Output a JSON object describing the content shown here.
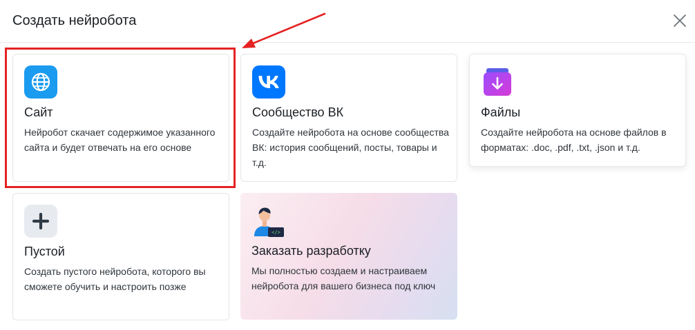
{
  "dialog": {
    "title": "Создать нейробота"
  },
  "cards": [
    {
      "title": "Сайт",
      "description": "Нейробот скачает содержимое указанного сайта и будет отвечать на его основе",
      "icon": "globe-icon"
    },
    {
      "title": "Сообщество ВК",
      "description": "Создайте нейробота на основе сообщества ВК: история сообщений, посты, товары и т.д.",
      "icon": "vk-logo-icon"
    },
    {
      "title": "Файлы",
      "description": "Создайте нейробота на основе файлов в форматах: .doc, .pdf, .txt, .json и т.д.",
      "icon": "file-download-icon"
    },
    {
      "title": "Пустой",
      "description": "Создать пустого нейробота, которого вы сможете обучить и настроить позже",
      "icon": "plus-icon"
    },
    {
      "title": "Заказать разработку",
      "description": "Мы полностью создаем и настраиваем нейробота для вашего бизнеса под ключ",
      "icon": "developer-avatar-icon"
    }
  ],
  "colors": {
    "accent_blue": "#1a9bf0",
    "vk_blue": "#0077ff",
    "annotation_red": "#e52222"
  }
}
